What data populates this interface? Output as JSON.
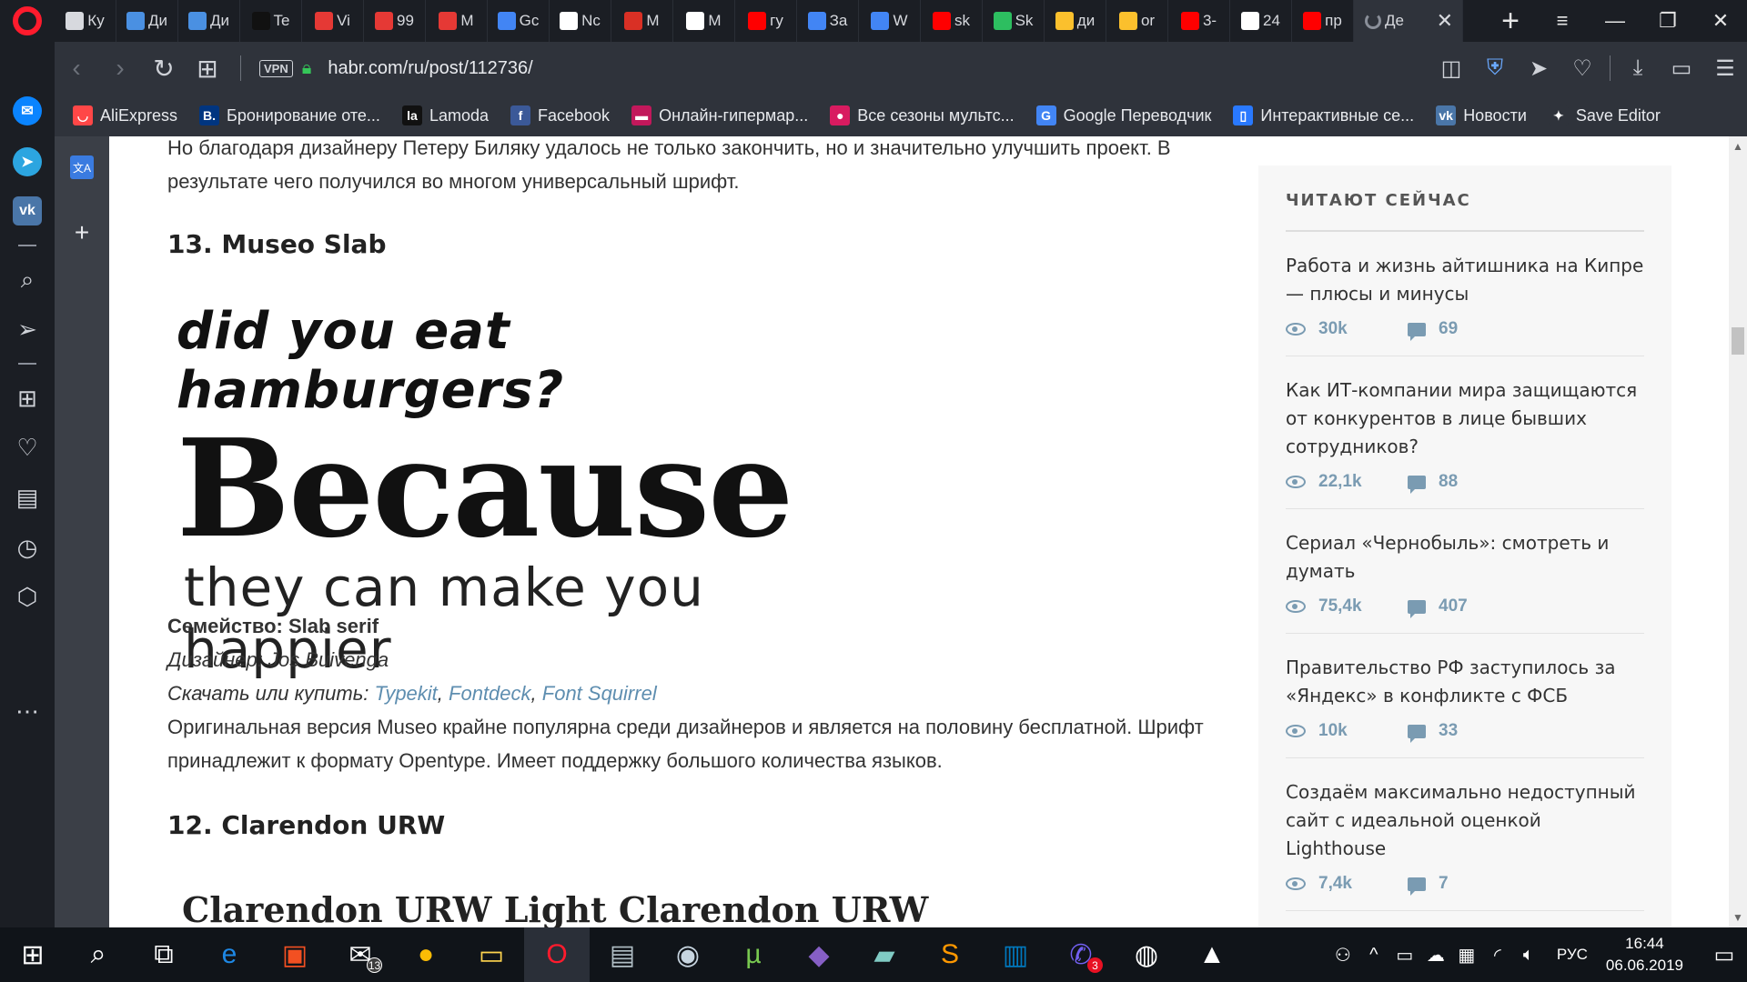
{
  "tabs": [
    {
      "label": "Ку",
      "color": "#d7d9de"
    },
    {
      "label": "Ди",
      "color": "#4a90e2"
    },
    {
      "label": "Ди",
      "color": "#4a90e2"
    },
    {
      "label": "Te",
      "color": "#111111"
    },
    {
      "label": "Vi",
      "color": "#e53935"
    },
    {
      "label": "99",
      "color": "#e53935"
    },
    {
      "label": "M",
      "color": "#e53935"
    },
    {
      "label": "Gc",
      "color": "#4285f4"
    },
    {
      "label": "Nc",
      "color": "#ffffff"
    },
    {
      "label": "M",
      "color": "#d93025"
    },
    {
      "label": "M",
      "color": "#ffffff"
    },
    {
      "label": "гу",
      "color": "#ff0000"
    },
    {
      "label": "За",
      "color": "#4285f4"
    },
    {
      "label": "W",
      "color": "#4285f4"
    },
    {
      "label": "sk",
      "color": "#ff0000"
    },
    {
      "label": "Sk",
      "color": "#2dbe60"
    },
    {
      "label": "ди",
      "color": "#fbc02d"
    },
    {
      "label": "or",
      "color": "#fbc02d"
    },
    {
      "label": "3-",
      "color": "#ff0000"
    },
    {
      "label": "24",
      "color": "#ffffff"
    },
    {
      "label": "пр",
      "color": "#ff0000"
    }
  ],
  "active_tab": {
    "label": "Де"
  },
  "address": {
    "url": "habr.com/ru/post/112736/",
    "vpn": "VPN"
  },
  "bookmarks": [
    {
      "label": "AliExpress",
      "icon": "aliexpress-icon",
      "color": "#ff4747",
      "glyph": "◡"
    },
    {
      "label": "Бронирование оте...",
      "icon": "booking-icon",
      "color": "#003580",
      "glyph": "B."
    },
    {
      "label": "Lamoda",
      "icon": "lamoda-icon",
      "color": "#111111",
      "glyph": "la"
    },
    {
      "label": "Facebook",
      "icon": "facebook-icon",
      "color": "#3b5998",
      "glyph": "f"
    },
    {
      "label": "Онлайн-гипермар...",
      "icon": "shop-icon",
      "color": "#c2185b",
      "glyph": "▬"
    },
    {
      "label": "Все сезоны мультс...",
      "icon": "cartoon-icon",
      "color": "#d81b60",
      "glyph": "●"
    },
    {
      "label": "Google Переводчик",
      "icon": "google-translate-icon",
      "color": "#4285f4",
      "glyph": "G"
    },
    {
      "label": "Интерактивные се...",
      "icon": "interactive-icon",
      "color": "#2979ff",
      "glyph": "▯"
    },
    {
      "label": "Новости",
      "icon": "vk-icon",
      "color": "#4a76a8",
      "glyph": "vk"
    },
    {
      "label": "Save Editor",
      "icon": "save-editor-icon",
      "color": "#2f333b",
      "glyph": "✦"
    }
  ],
  "article": {
    "intro": "Но благодаря дизайнеру Петеру Биляку удалось не только закончить, но и значительно улучшить проект. В результате чего получился во многом универсальный шрифт.",
    "section13": {
      "heading": "13. Museo Slab",
      "image_lines": [
        "did you eat hamburgers?",
        "Because",
        "they can make you happier"
      ],
      "family_label": "Семейство: Slab serif",
      "designer": "Дизайнер: Jos Buivenga",
      "download_label": "Скачать или купить: ",
      "links": [
        "Typekit",
        "Fontdeck",
        "Font Squirrel"
      ],
      "sep": ", ",
      "desc": "Оригинальная версия Museo крайне популярна среди дизайнеров и является на половину бесплатной. Шрифт принадлежит к формату Opentype. Имеет поддержку большого количества языков."
    },
    "section12": {
      "heading": "12. Clarendon URW",
      "image_text": "Clarendon URW Light Clarendon URW"
    }
  },
  "reading_now": {
    "title": "ЧИТАЮТ СЕЙЧАС",
    "items": [
      {
        "title": "Работа и жизнь айтишника на Кипре — плюсы и минусы",
        "views": "30k",
        "comments": "69"
      },
      {
        "title": "Как ИТ-компании мира защищаются от конкурентов в лице бывших сотрудников?",
        "views": "22,1k",
        "comments": "88"
      },
      {
        "title": "Сериал «Чернобыль»: смотреть и думать",
        "views": "75,4k",
        "comments": "407"
      },
      {
        "title": "Правительство РФ заступилось за «Яндекс» в конфликте с ФСБ",
        "views": "10k",
        "comments": "33"
      },
      {
        "title": "Создаём максимально недоступный сайт с идеальной оценкой Lighthouse",
        "views": "7,4k",
        "comments": "7"
      }
    ]
  },
  "taskbar": {
    "apps": [
      {
        "name": "cortana-search-icon",
        "glyph": "⌕",
        "color": "#ffffff"
      },
      {
        "name": "task-view-icon",
        "glyph": "⧉",
        "color": "#ffffff"
      },
      {
        "name": "edge-icon",
        "glyph": "e",
        "color": "#1e88e5"
      },
      {
        "name": "store-icon",
        "glyph": "▣",
        "color": "#f25022"
      },
      {
        "name": "mail-icon",
        "glyph": "✉",
        "color": "#ffffff",
        "badge": "13"
      },
      {
        "name": "chrome-icon",
        "glyph": "●",
        "color": "#fbbc05"
      },
      {
        "name": "explorer-icon",
        "glyph": "▭",
        "color": "#ffd54f"
      },
      {
        "name": "opera-icon",
        "glyph": "O",
        "color": "#ff1b2d",
        "active": true
      },
      {
        "name": "scanner-icon",
        "glyph": "▤",
        "color": "#b0bec5"
      },
      {
        "name": "steam-icon",
        "glyph": "◉",
        "color": "#c7d5e0"
      },
      {
        "name": "utorrent-icon",
        "glyph": "µ",
        "color": "#78c850"
      },
      {
        "name": "visual-studio-icon",
        "glyph": "◆",
        "color": "#865fc5"
      },
      {
        "name": "notes-icon",
        "glyph": "▰",
        "color": "#80cbc4"
      },
      {
        "name": "sublime-icon",
        "glyph": "S",
        "color": "#ff9800"
      },
      {
        "name": "trello-icon",
        "glyph": "▥",
        "color": "#0079bf"
      },
      {
        "name": "viber-icon",
        "glyph": "✆",
        "color": "#7360f2",
        "badge": "3"
      },
      {
        "name": "github-icon",
        "glyph": "◍",
        "color": "#ffffff"
      },
      {
        "name": "photos-icon",
        "glyph": "▲",
        "color": "#ffffff"
      }
    ],
    "lang": "РУС",
    "time": "16:44",
    "date": "06.06.2019"
  }
}
